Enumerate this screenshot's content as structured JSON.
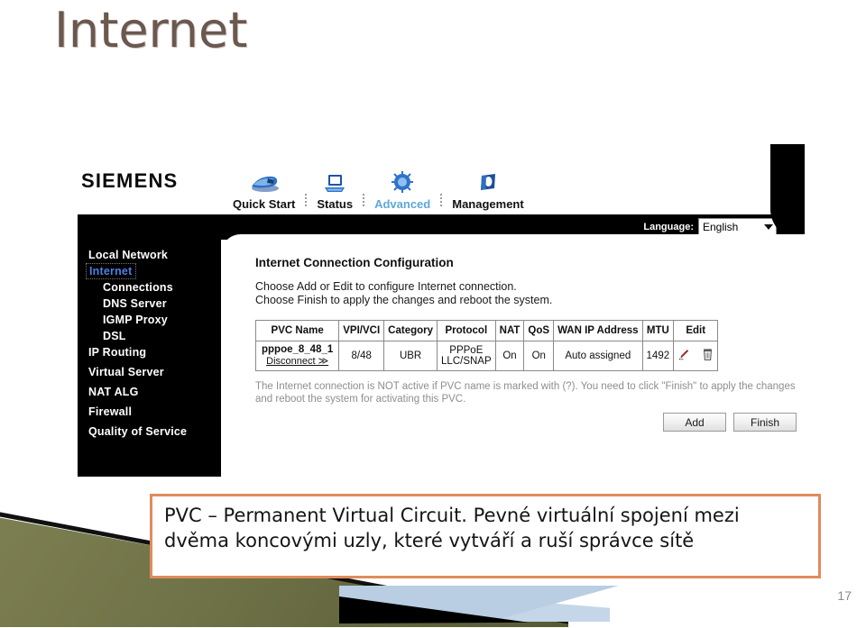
{
  "slide": {
    "title": "Internet",
    "page_number": "17",
    "title_color": "#6b584e",
    "caption_border_color": "#e08b5c"
  },
  "caption": {
    "line1": "PVC – Permanent Virtual Circuit. Pevné virtuální spojení mezi",
    "line2": "dvěma koncovými uzly, které vytváří a ruší správce sítě"
  },
  "router": {
    "brand": "SIEMENS",
    "nav": [
      {
        "label": "Quick Start",
        "icon": "rocket-icon",
        "active": false
      },
      {
        "label": "Status",
        "icon": "laptop-icon",
        "active": false
      },
      {
        "label": "Advanced",
        "icon": "gear-chip-icon",
        "active": true
      },
      {
        "label": "Management",
        "icon": "book-icon",
        "active": false
      }
    ],
    "language": {
      "label": "Language:",
      "value": "English",
      "caret_icon": "chevron-down-icon"
    },
    "sidebar": [
      {
        "label": "Local Network",
        "level": "top",
        "active": false
      },
      {
        "label": "Internet",
        "level": "top",
        "active": true
      },
      {
        "label": "Connections",
        "level": "sub",
        "active": false
      },
      {
        "label": "DNS Server",
        "level": "sub",
        "active": false
      },
      {
        "label": "IGMP Proxy",
        "level": "sub",
        "active": false
      },
      {
        "label": "DSL",
        "level": "sub",
        "active": false
      },
      {
        "label": "IP Routing",
        "level": "top",
        "active": false
      },
      {
        "label": "Virtual Server",
        "level": "top",
        "active": false
      },
      {
        "label": "NAT ALG",
        "level": "top",
        "active": false
      },
      {
        "label": "Firewall",
        "level": "top",
        "active": false
      },
      {
        "label": "Quality of Service",
        "level": "top",
        "active": false
      }
    ],
    "panel": {
      "title": "Internet Connection Configuration",
      "desc_line1": "Choose Add or Edit to configure Internet connection.",
      "desc_line2": "Choose Finish to apply the changes and reboot the system."
    },
    "table": {
      "headers": [
        "PVC Name",
        "VPI/VCI",
        "Category",
        "Protocol",
        "NAT",
        "QoS",
        "WAN IP Address",
        "MTU",
        "Edit"
      ],
      "rows": [
        {
          "pvc_name": "pppoe_8_48_1",
          "disconnect_label": "Disconnect ≫",
          "vpi_vci": "8/48",
          "category": "UBR",
          "protocol_line1": "PPPoE",
          "protocol_line2": "LLC/SNAP",
          "nat": "On",
          "qos": "On",
          "wan_ip": "Auto assigned",
          "mtu": "1492",
          "edit_icons": [
            "pencil-icon",
            "trash-icon"
          ]
        }
      ]
    },
    "note": "The Internet connection is NOT active if PVC name is marked with (?). You need to click \"Finish\" to apply the changes and reboot the system for activating this PVC.",
    "buttons": {
      "add": "Add",
      "finish": "Finish"
    }
  }
}
